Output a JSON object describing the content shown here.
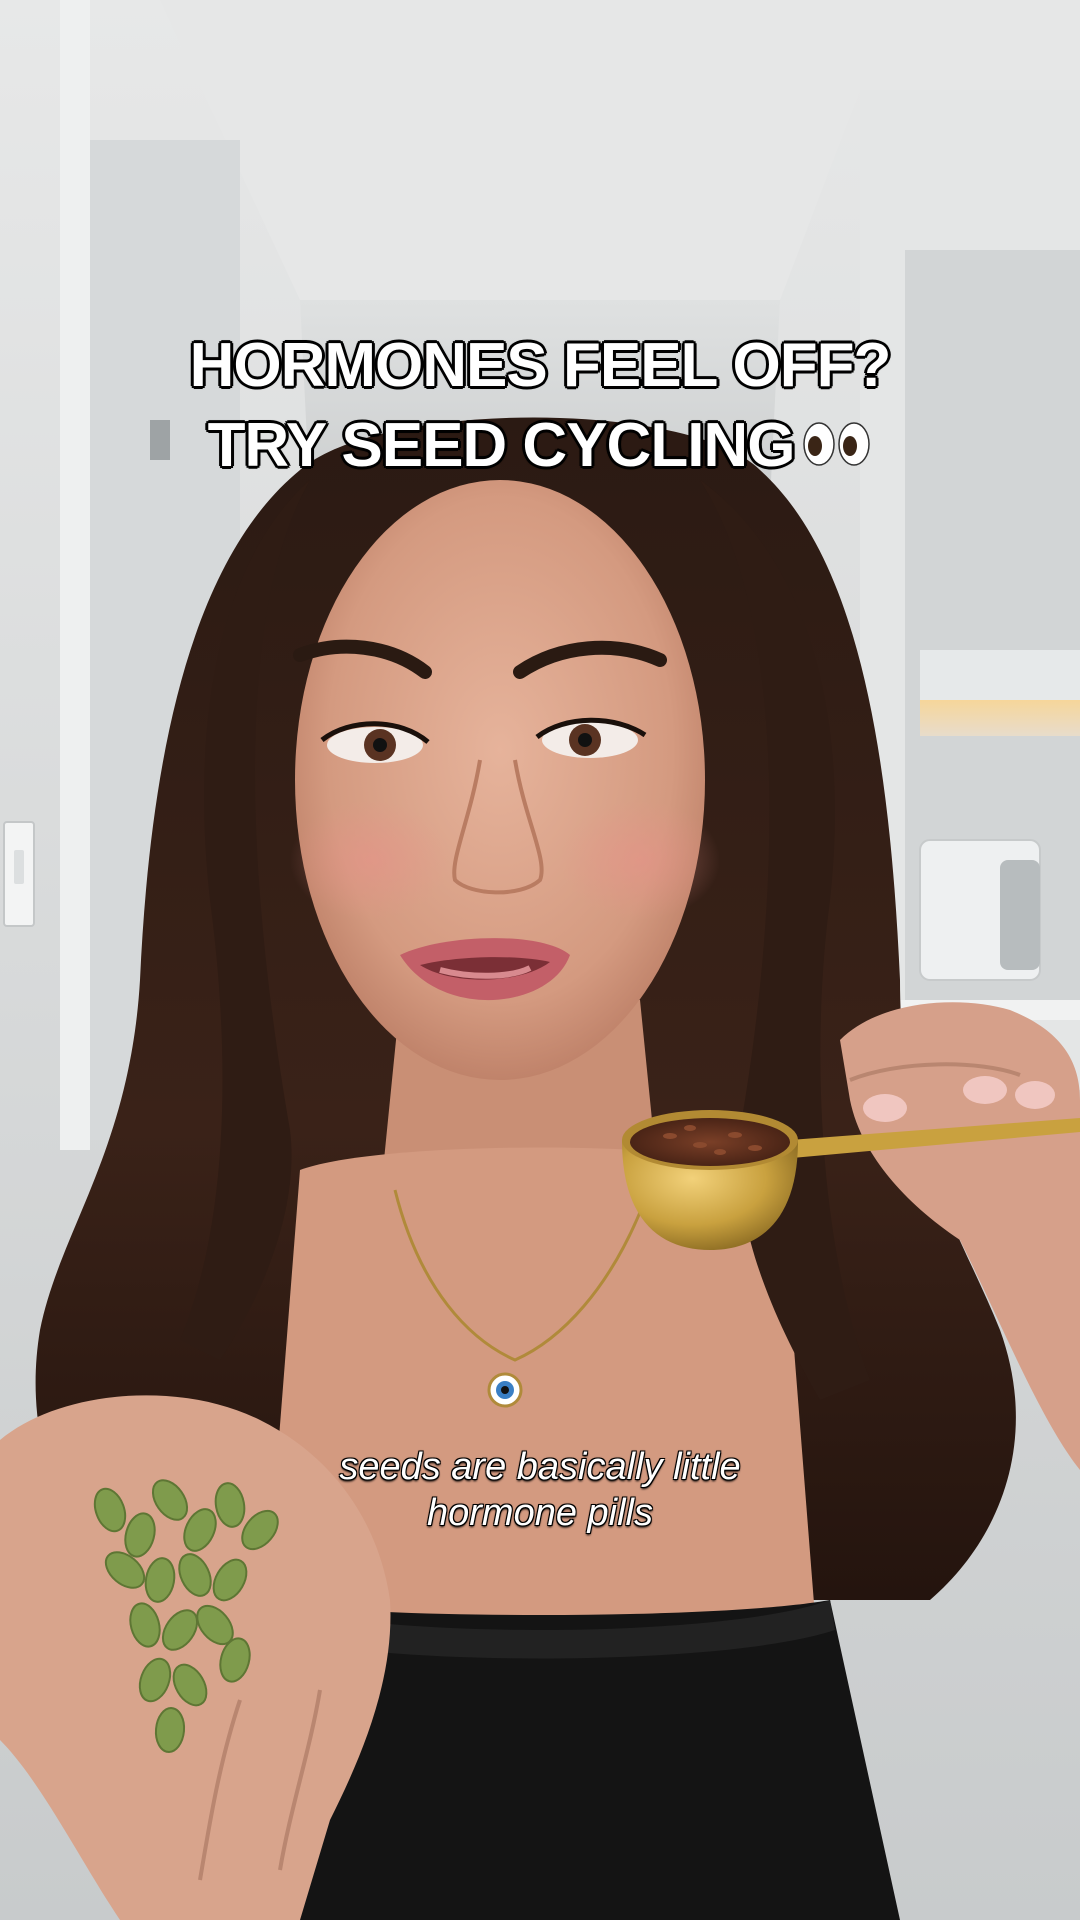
{
  "overlay": {
    "title_lines": [
      "HORMONES FEEL OFF?",
      "TRY SEED CYCLING"
    ],
    "title_emoji": "eyes-icon",
    "subtitle_lines": [
      "seeds are basically little",
      "hormone pills"
    ]
  },
  "colors": {
    "wall": "#d9dcdd",
    "ceiling": "#e4e6e6",
    "hair": "#2a1a14",
    "skin": "#d9a188",
    "top": "#121212",
    "scoop_gold": "#c9a13f",
    "flax_seed": "#5a2f1e",
    "pumpkin_seed": "#7e9a4a"
  }
}
